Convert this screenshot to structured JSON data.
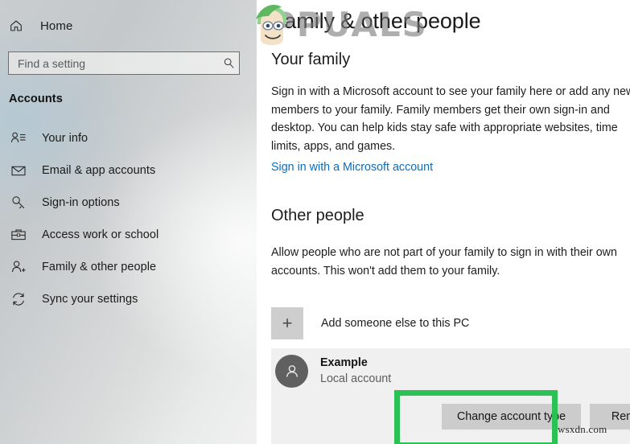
{
  "sidebar": {
    "home": {
      "label": "Home",
      "icon": "home-icon"
    },
    "search": {
      "placeholder": "Find a setting",
      "value": "",
      "icon": "search-icon"
    },
    "section_heading": "Accounts",
    "items": [
      {
        "label": "Your info",
        "icon": "user-list-icon"
      },
      {
        "label": "Email & app accounts",
        "icon": "envelope-icon"
      },
      {
        "label": "Sign-in options",
        "icon": "key-icon"
      },
      {
        "label": "Access work or school",
        "icon": "briefcase-icon"
      },
      {
        "label": "Family & other people",
        "icon": "user-add-icon",
        "selected": true
      },
      {
        "label": "Sync your settings",
        "icon": "sync-icon"
      }
    ]
  },
  "main": {
    "page_title": "Family & other people",
    "your_family": {
      "heading": "Your family",
      "description": "Sign in with a Microsoft account to see your family here or add any new members to your family. Family members get their own sign-in and desktop. You can help kids stay safe with appropriate websites, time limits, apps, and games.",
      "link_label": "Sign in with a Microsoft account"
    },
    "other_people": {
      "heading": "Other people",
      "description": "Allow people who are not part of your family to sign in with their own accounts. This won't add them to your family.",
      "add_user_label": "Add someone else to this PC",
      "add_user_icon": "plus-icon",
      "account": {
        "name": "Example",
        "type": "Local account",
        "avatar_icon": "person-avatar-icon",
        "change_type_button": "Change account type",
        "remove_button": "Remove"
      }
    }
  },
  "annotations": {
    "highlight_color": "#2cc154",
    "highlight_target": "change-account-type-button"
  },
  "watermarks": {
    "brand": "PPUALS",
    "site": "wsxdn.com"
  },
  "colors": {
    "link": "#0b6cc0",
    "button_face": "#cccccc",
    "selected_row": "#f0f0f0",
    "avatar": "#606060",
    "highlight_green": "#2cc154"
  }
}
